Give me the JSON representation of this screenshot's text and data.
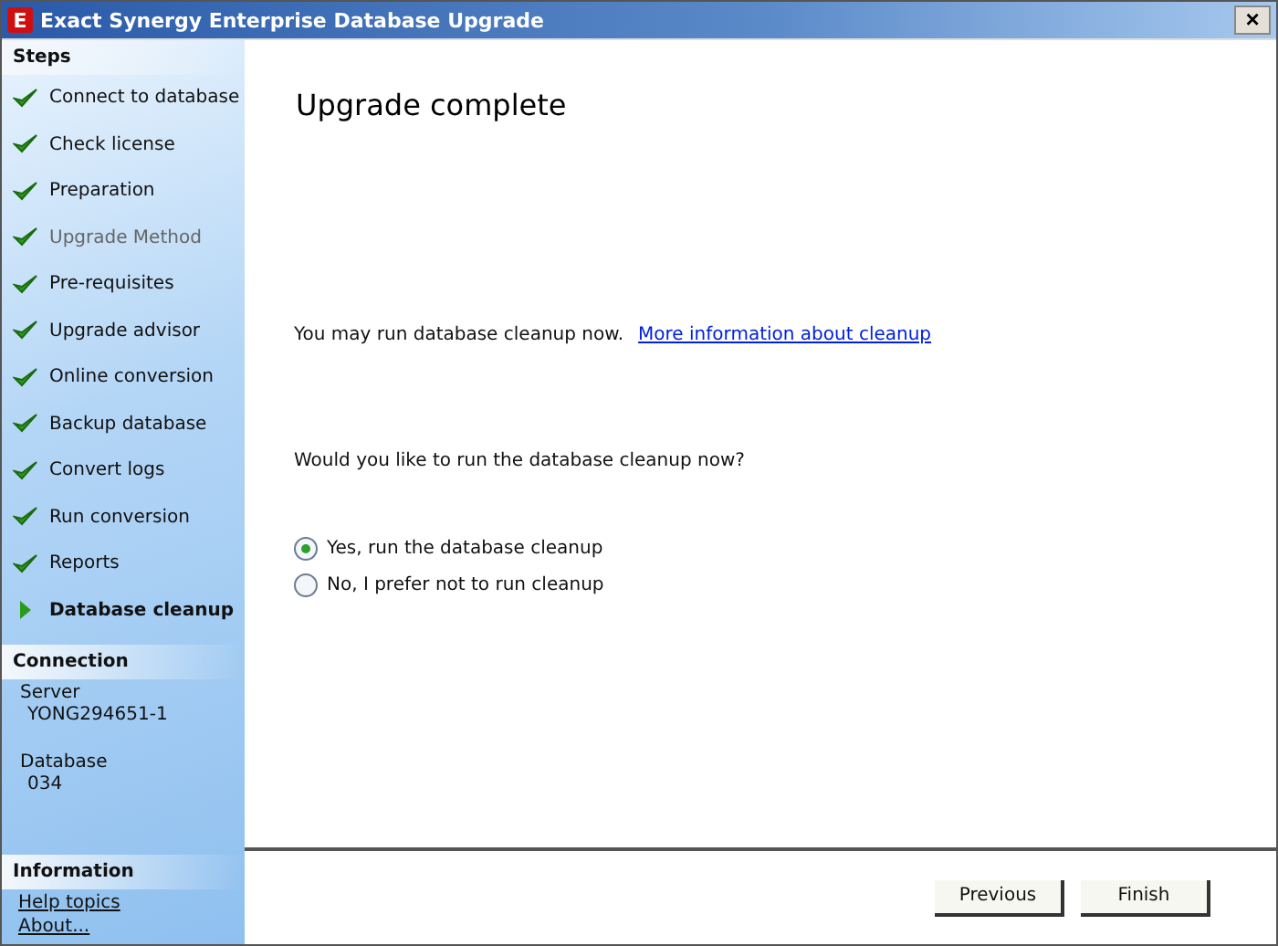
{
  "window": {
    "title": "Exact Synergy Enterprise Database Upgrade",
    "logo": "E",
    "close": "×"
  },
  "steps_header": "Steps",
  "steps": [
    {
      "label": "Connect to database",
      "kind": "done",
      "disabled": false
    },
    {
      "label": "Check license",
      "kind": "done",
      "disabled": false
    },
    {
      "label": "Preparation",
      "kind": "done",
      "disabled": false
    },
    {
      "label": "Upgrade Method",
      "kind": "done",
      "disabled": true
    },
    {
      "label": "Pre-requisites",
      "kind": "done",
      "disabled": false
    },
    {
      "label": "Upgrade advisor",
      "kind": "done",
      "disabled": false
    },
    {
      "label": "Online conversion",
      "kind": "done",
      "disabled": false
    },
    {
      "label": "Backup database",
      "kind": "done",
      "disabled": false
    },
    {
      "label": "Convert logs",
      "kind": "done",
      "disabled": false
    },
    {
      "label": "Run conversion",
      "kind": "done",
      "disabled": false
    },
    {
      "label": "Reports",
      "kind": "done",
      "disabled": false
    },
    {
      "label": "Database cleanup",
      "kind": "current",
      "disabled": false
    }
  ],
  "connection": {
    "header": "Connection",
    "server_label": "Server",
    "server": "YONG294651-1",
    "database_label": "Database",
    "database": "034"
  },
  "information": {
    "header": "Information",
    "links": [
      "Help topics",
      "About..."
    ]
  },
  "heading": "Upgrade complete",
  "info_text": "You may run database cleanup now.",
  "info_link": "More information about cleanup",
  "question": "Would you like to run the database cleanup now?",
  "options": [
    {
      "label": "Yes, run the database cleanup",
      "selected": true
    },
    {
      "label": "No, I prefer not to run cleanup",
      "selected": false
    }
  ],
  "buttons": [
    "Previous",
    "Finish"
  ]
}
